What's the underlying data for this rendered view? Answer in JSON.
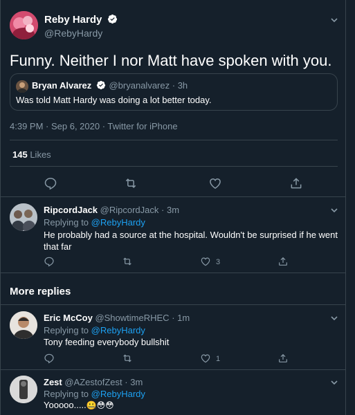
{
  "main_tweet": {
    "author_name": "Reby Hardy",
    "author_handle": "@RebyHardy",
    "text": "Funny. Neither I nor Matt have spoken with you.",
    "quoted": {
      "author_name": "Bryan Alvarez",
      "author_handle": "@bryanalvarez",
      "sep": "·",
      "time": "3h",
      "text": "Was told Matt Hardy was doing a lot better today."
    },
    "timestamp": "4:39 PM · Sep 6, 2020 · Twitter for iPhone",
    "likes_count": "145",
    "likes_label": "Likes"
  },
  "replies": [
    {
      "author_name": "RipcordJack",
      "author_handle": "@RipcordJack",
      "sep": "·",
      "time": "3m",
      "replying_label": "Replying to",
      "replying_handle": "@RebyHardy",
      "text_line1": "He probably had a source at the hospital. Wouldn't be surprised if he went",
      "text_line2": "that far",
      "like_count": "3"
    }
  ],
  "more_replies_title": "More replies",
  "more": [
    {
      "author_name": "Eric McCoy",
      "author_handle": "@ShowtimeRHEC",
      "sep": "·",
      "time": "1m",
      "replying_label": "Replying to",
      "replying_handle": "@RebyHardy",
      "text": "Tony feeding everybody bullshit",
      "like_count": "1"
    },
    {
      "author_name": "Zest",
      "author_handle": "@AZestofZest",
      "sep": "·",
      "time": "3m",
      "replying_label": "Replying to",
      "replying_handle": "@RebyHardy",
      "text": "Yooooo.....",
      "emojis": "🤐😳😳"
    }
  ],
  "colors": {
    "background": "#15202b",
    "border": "#38444d",
    "muted": "#8899a6",
    "accent": "#1da1f2",
    "verified": "#ffffff"
  }
}
